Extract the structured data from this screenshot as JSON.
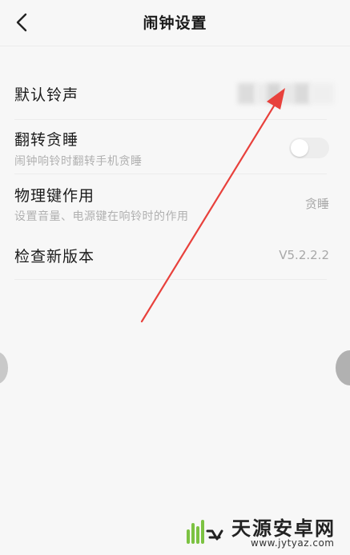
{
  "header": {
    "title": "闹钟设置",
    "back_icon": "chevron-left-icon"
  },
  "settings": {
    "ringtone": {
      "title": "默认铃声",
      "value": ""
    },
    "flip_snooze": {
      "title": "翻转贪睡",
      "subtitle": "闹钟响铃时翻转手机贪睡",
      "enabled": false
    },
    "physical_key": {
      "title": "物理键作用",
      "subtitle": "设置音量、电源键在响铃时的作用",
      "value": "贪睡"
    },
    "check_version": {
      "title": "检查新版本",
      "value": "V5.2.2.2"
    }
  },
  "watermark": {
    "name": "天源安卓网",
    "url": "www.jytyaz.com"
  },
  "colors": {
    "background": "#f7f7f7",
    "annotation_arrow": "#e8413c",
    "watermark_green": "#7cc242"
  }
}
